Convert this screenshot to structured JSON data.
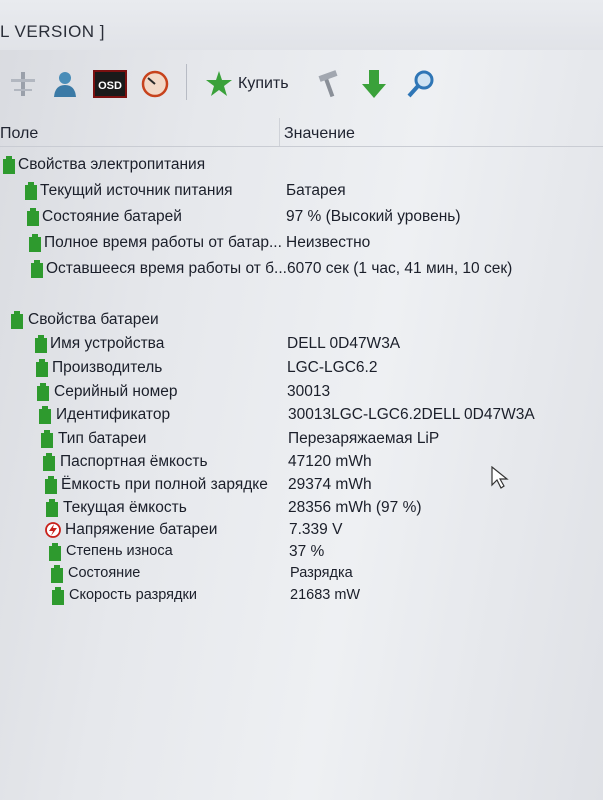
{
  "window": {
    "title": "L VERSION ]"
  },
  "toolbar": {
    "buy_label": "Купить"
  },
  "columns": {
    "field": "Поле",
    "value": "Значение"
  },
  "power_section": {
    "label": "Свойства электропитания",
    "rows": [
      {
        "name": "Текущий источник питания",
        "value": "Батарея"
      },
      {
        "name": "Состояние батарей",
        "value": "97 % (Высокий уровень)"
      },
      {
        "name": "Полное время работы от батар...",
        "value": "Неизвестно"
      },
      {
        "name": "Оставшееся время работы от б...",
        "value": "6070 сек (1 час, 41 мин, 10 сек)"
      }
    ]
  },
  "battery_section": {
    "label": "Свойства батареи",
    "rows": [
      {
        "name": "Имя устройства",
        "value": "DELL 0D47W3A"
      },
      {
        "name": "Производитель",
        "value": "LGC-LGC6.2"
      },
      {
        "name": "Серийный номер",
        "value": "30013"
      },
      {
        "name": "Идентификатор",
        "value": "30013LGC-LGC6.2DELL 0D47W3A"
      },
      {
        "name": "Тип батареи",
        "value": "Перезаряжаемая LiP"
      },
      {
        "name": "Паспортная ёмкость",
        "value": "47120 mWh"
      },
      {
        "name": "Ёмкость при полной зарядке",
        "value": "29374 mWh"
      },
      {
        "name": "Текущая ёмкость",
        "value": "28356 mWh  (97 %)"
      },
      {
        "name": "Напряжение батареи",
        "value": "7.339 V"
      },
      {
        "name": "Степень износа",
        "value": "37 %"
      },
      {
        "name": "Состояние",
        "value": "Разрядка"
      },
      {
        "name": "Скорость разрядки",
        "value": "21683 mW"
      }
    ]
  },
  "colors": {
    "battery_green": "#2e9a2e",
    "voltage_red": "#c8201a"
  }
}
